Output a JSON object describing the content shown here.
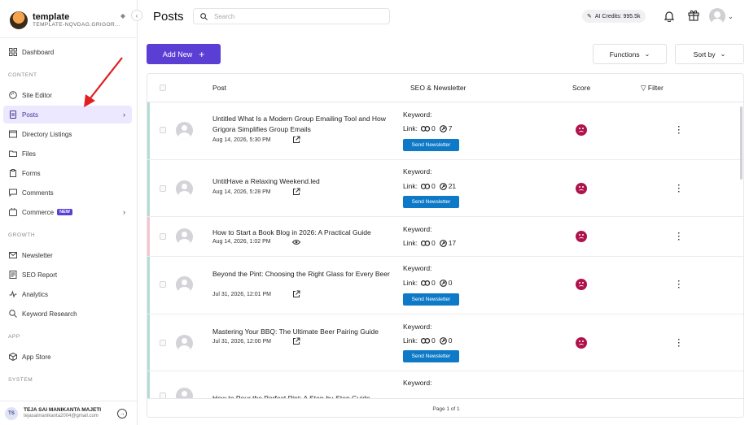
{
  "brand": {
    "name": "template",
    "subtitle": "TEMPLATE-NQVDAG.GRIGOR..."
  },
  "sidebar": {
    "top_items": [
      {
        "label": "Dashboard"
      }
    ],
    "sections": [
      {
        "label": "CONTENT",
        "items": [
          "Site Editor",
          "Posts",
          "Directory Listings",
          "Files",
          "Forms",
          "Comments",
          "Commerce"
        ]
      },
      {
        "label": "GROWTH",
        "items": [
          "Newsletter",
          "SEO Report",
          "Analytics",
          "Keyword Research"
        ]
      },
      {
        "label": "APP",
        "items": [
          "App Store"
        ]
      },
      {
        "label": "SYSTEM",
        "items": []
      }
    ],
    "active_item": "Posts",
    "new_badge": "NEW"
  },
  "user": {
    "initials": "TS",
    "name": "TEJA SAI MANIKANTA MAJETI",
    "email": "tejasaimanikanta2004@gmail.com"
  },
  "header": {
    "title": "Posts",
    "search_placeholder": "Search",
    "credits": "AI Credits: 995.5k"
  },
  "toolbar": {
    "add_new": "Add New",
    "functions": "Functions",
    "sort_by": "Sort by"
  },
  "table": {
    "columns": {
      "post": "Post",
      "seo": "SEO & Newsletter",
      "score": "Score",
      "filter": "Filter"
    },
    "keyword_label": "Keyword:",
    "link_label": "Link:",
    "send_label": "Send Newsletter",
    "rows": [
      {
        "title": "Untitled What Is a Modern Group Emailing Tool and How Grigora Simplifies Group Emails",
        "date": "Aug 14, 2026, 5:30 PM",
        "links": "0",
        "views": "7",
        "status_color": "#b5dcd2",
        "icon": "external",
        "send": true
      },
      {
        "title": "UntitHave a Relaxing Weekend.led",
        "date": "Aug 14, 2026, 5:28 PM",
        "links": "0",
        "views": "21",
        "status_color": "#b5dcd2",
        "icon": "external",
        "send": true
      },
      {
        "title": "How to Start a Book Blog in 2026: A Practical Guide",
        "date": "Aug 14, 2026, 1:02 PM",
        "links": "0",
        "views": "17",
        "status_color": "#f4c6d0",
        "icon": "eye",
        "send": false
      },
      {
        "title": "Beyond the Pint: Choosing the Right Glass for Every Beer",
        "date": "Jul 31, 2026, 12:01 PM",
        "links": "0",
        "views": "0",
        "status_color": "#b5dcd2",
        "icon": "external",
        "send": true
      },
      {
        "title": "Mastering Your BBQ: The Ultimate Beer Pairing Guide",
        "date": "Jul 31, 2026, 12:00 PM",
        "links": "0",
        "views": "0",
        "status_color": "#b5dcd2",
        "icon": "external",
        "send": true
      },
      {
        "title": "How to Pour the Perfect Pint: A Step-by-Step Guide",
        "date": "",
        "links": "",
        "views": "",
        "status_color": "#b5dcd2",
        "icon": "",
        "send": false
      }
    ],
    "footer": "Page 1 of 1"
  },
  "colors": {
    "primary": "#5b3fd4",
    "send_button": "#0d79c7",
    "score_bad": "#b0134b",
    "annotation_arrow": "#e02020"
  }
}
